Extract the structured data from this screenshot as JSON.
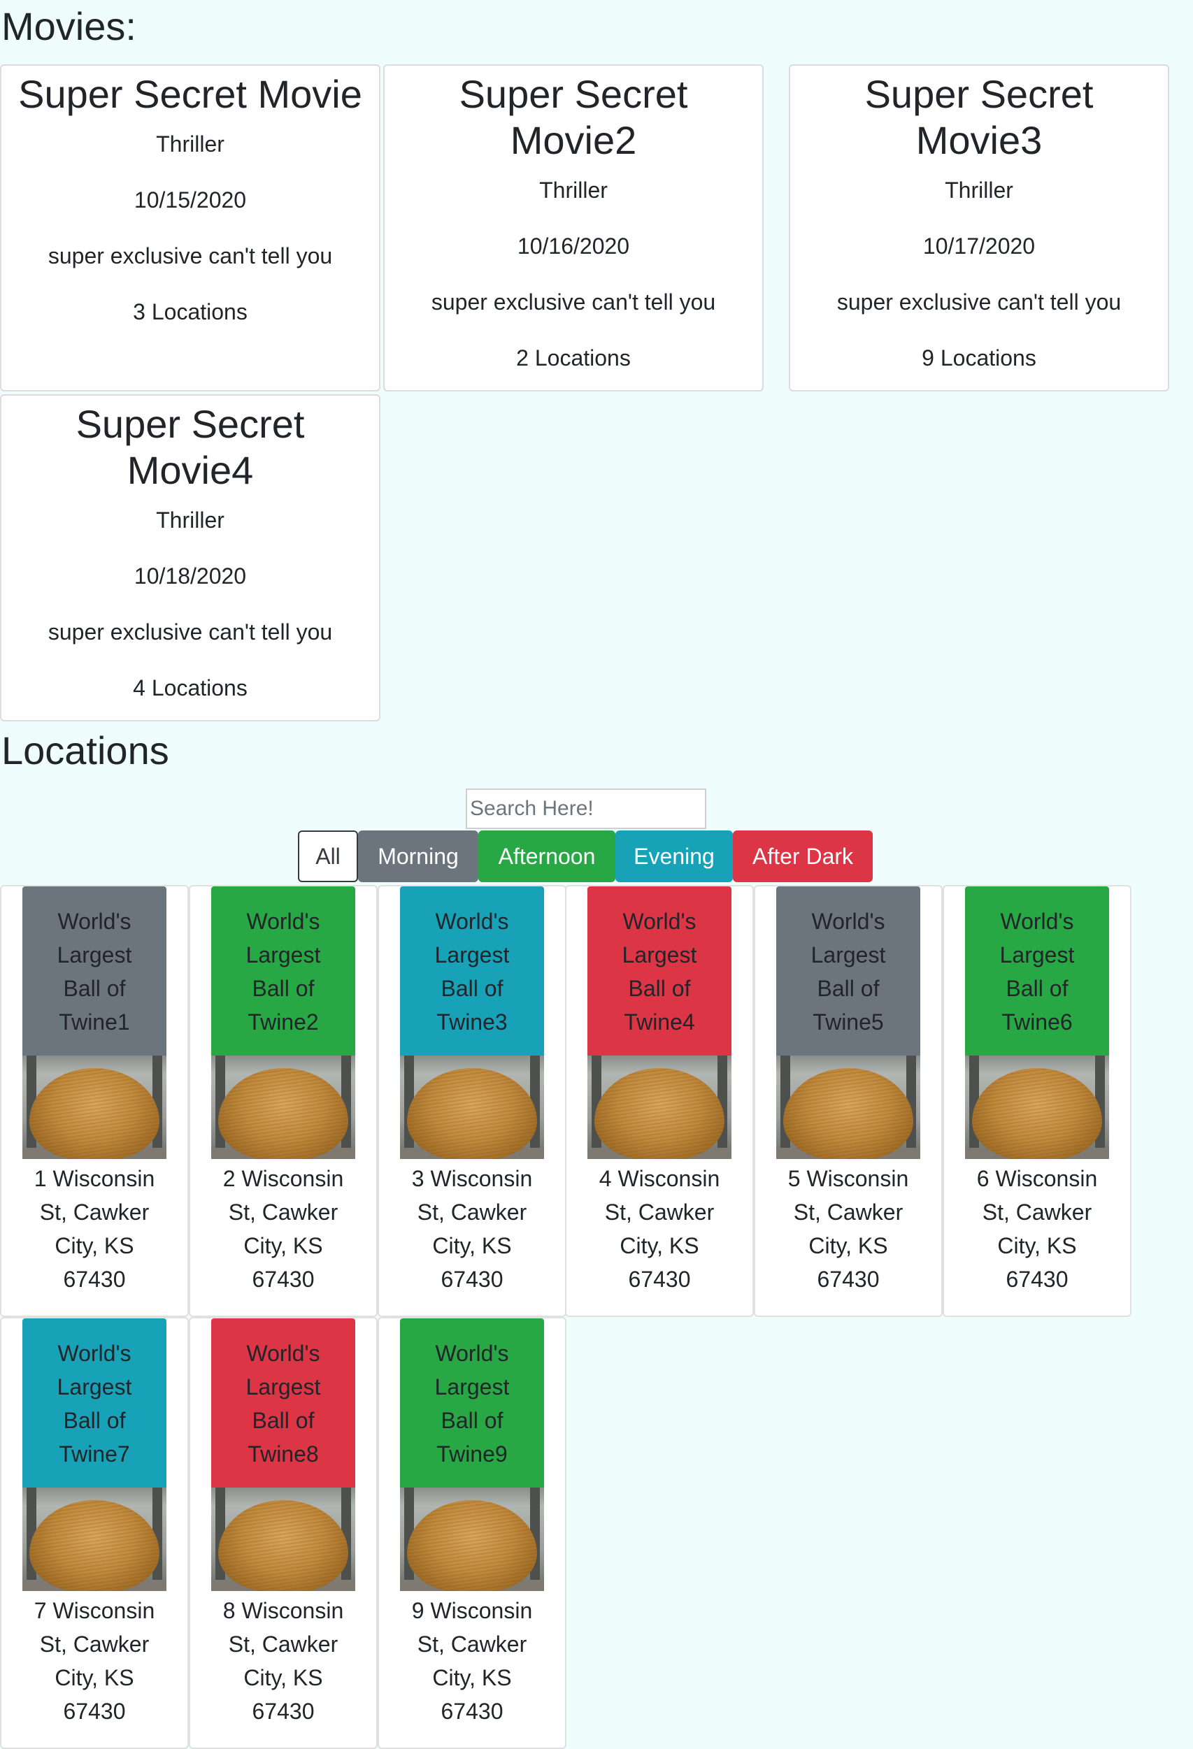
{
  "movies_heading": "Movies:",
  "movies": [
    {
      "title": "Super Secret Movie",
      "genre": "Thriller",
      "date": "10/15/2020",
      "description": "super exclusive can't tell you",
      "locations": "3 Locations"
    },
    {
      "title": "Super Secret Movie2",
      "genre": "Thriller",
      "date": "10/16/2020",
      "description": "super exclusive can't tell you",
      "locations": "2 Locations"
    },
    {
      "title": "Super Secret Movie3",
      "genre": "Thriller",
      "date": "10/17/2020",
      "description": "super exclusive can't tell you",
      "locations": "9 Locations"
    },
    {
      "title": "Super Secret Movie4",
      "genre": "Thriller",
      "date": "10/18/2020",
      "description": "super exclusive can't tell you",
      "locations": "4 Locations"
    }
  ],
  "locations_heading": "Locations",
  "search": {
    "placeholder": "Search Here!",
    "value": ""
  },
  "filters": [
    "All",
    "Morning",
    "Afternoon",
    "Evening",
    "After Dark"
  ],
  "colors": {
    "morning": "#6c757d",
    "afternoon": "#28a745",
    "evening": "#17a2b8",
    "after_dark": "#dc3545",
    "background": "#effdfd"
  },
  "locations": [
    {
      "name_lines": [
        "World's",
        "Largest",
        "Ball of",
        "Twine1"
      ],
      "address_lines": [
        "1 Wisconsin",
        "St, Cawker",
        "City, KS",
        "67430"
      ],
      "time": "Morning"
    },
    {
      "name_lines": [
        "World's",
        "Largest",
        "Ball of",
        "Twine2"
      ],
      "address_lines": [
        "2 Wisconsin",
        "St, Cawker",
        "City, KS",
        "67430"
      ],
      "time": "Afternoon"
    },
    {
      "name_lines": [
        "World's",
        "Largest",
        "Ball of",
        "Twine3"
      ],
      "address_lines": [
        "3 Wisconsin",
        "St, Cawker",
        "City, KS",
        "67430"
      ],
      "time": "Evening"
    },
    {
      "name_lines": [
        "World's",
        "Largest",
        "Ball of",
        "Twine4"
      ],
      "address_lines": [
        "4 Wisconsin",
        "St, Cawker",
        "City, KS",
        "67430"
      ],
      "time": "After Dark"
    },
    {
      "name_lines": [
        "World's",
        "Largest",
        "Ball of",
        "Twine5"
      ],
      "address_lines": [
        "5 Wisconsin",
        "St, Cawker",
        "City, KS",
        "67430"
      ],
      "time": "Morning"
    },
    {
      "name_lines": [
        "World's",
        "Largest",
        "Ball of",
        "Twine6"
      ],
      "address_lines": [
        "6 Wisconsin",
        "St, Cawker",
        "City, KS",
        "67430"
      ],
      "time": "Afternoon"
    },
    {
      "name_lines": [
        "World's",
        "Largest",
        "Ball of",
        "Twine7"
      ],
      "address_lines": [
        "7 Wisconsin",
        "St, Cawker",
        "City, KS",
        "67430"
      ],
      "time": "Evening"
    },
    {
      "name_lines": [
        "World's",
        "Largest",
        "Ball of",
        "Twine8"
      ],
      "address_lines": [
        "8 Wisconsin",
        "St, Cawker",
        "City, KS",
        "67430"
      ],
      "time": "After Dark"
    },
    {
      "name_lines": [
        "World's",
        "Largest",
        "Ball of",
        "Twine9"
      ],
      "address_lines": [
        "9 Wisconsin",
        "St, Cawker",
        "City, KS",
        "67430"
      ],
      "time": "Afternoon"
    }
  ]
}
